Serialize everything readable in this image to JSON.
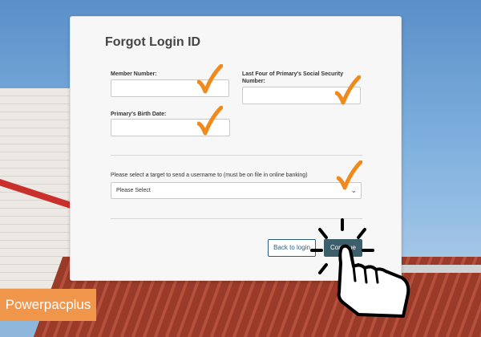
{
  "form": {
    "title": "Forgot Login ID",
    "member_number_label": "Member Number:",
    "ssn_label_line1": "Last Four of Primary's Social Security",
    "ssn_label_line2": "Number:",
    "birth_date_label": "Primary's Birth Date:",
    "target_label": "Please select a target to send a username to (must be on file in online banking)",
    "target_select_value": "Please Select",
    "back_button": "Back to login",
    "continue_button": "Continue"
  },
  "watermark": {
    "text": "Powerpacplus"
  },
  "colors": {
    "check": "#f08a1c",
    "continue_bg": "#3d5f6c",
    "back_border": "#2b5e8a",
    "watermark_bg": "#f0964a"
  },
  "icons": [
    "checkmark-icon",
    "chevron-down-icon",
    "hand-pointer-icon"
  ]
}
